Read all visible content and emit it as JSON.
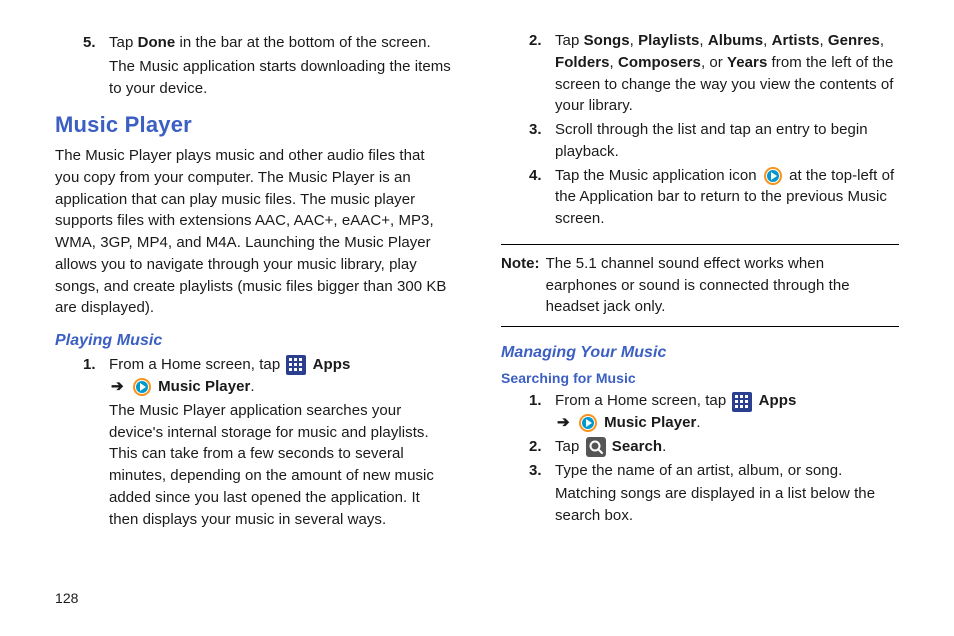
{
  "page_number": "128",
  "left": {
    "step5_num": "5.",
    "step5_a": "Tap ",
    "step5_done": "Done",
    "step5_b": " in the bar at the bottom of the screen.",
    "step5_follow": "The Music application starts downloading the items to your device.",
    "section_title": "Music Player",
    "section_desc": "The Music Player plays music and other audio files that you copy from your computer. The Music Player is an application that can play music files. The music player supports files with extensions AAC, AAC+, eAAC+, MP3, WMA, 3GP, MP4, and M4A. Launching the Music Player allows you to navigate through your music library, play songs, and create playlists (music files bigger than 300 KB are displayed).",
    "playing_title": "Playing Music",
    "pm1_num": "1.",
    "pm1_a": "From a Home screen, tap ",
    "pm1_apps": "Apps",
    "pm1_arrow": "➔",
    "pm1_mp": "Music Player",
    "pm1_period": ".",
    "pm1_follow": "The Music Player application searches your device's internal storage for music and playlists. This can take from a few seconds to several minutes, depending on the amount of new music added since you last opened the application. It then displays your music in several ways."
  },
  "right": {
    "r2_num": "2.",
    "r2_a": "Tap ",
    "r2_songs": "Songs",
    "r2_c1": ", ",
    "r2_playlists": "Playlists",
    "r2_c2": ", ",
    "r2_albums": "Albums",
    "r2_c3": ", ",
    "r2_artists": "Artists",
    "r2_c4": ", ",
    "r2_genres": "Genres",
    "r2_c5": ", ",
    "r2_folders": "Folders",
    "r2_c6": ", ",
    "r2_composers": "Composers",
    "r2_c7": ", or ",
    "r2_years": "Years",
    "r2_b": " from the left of the screen to change the way you view the contents of your library.",
    "r3_num": "3.",
    "r3_txt": "Scroll through the list and tap an entry to begin playback.",
    "r4_num": "4.",
    "r4_a": "Tap the Music application icon ",
    "r4_b": " at the top-left of the Application bar to return to the previous Music screen.",
    "note_label": "Note:",
    "note_text": "The 5.1 channel sound effect works when earphones or sound is connected through the headset jack only.",
    "manage_title": "Managing Your Music",
    "search_title": "Searching for Music",
    "s1_num": "1.",
    "s1_a": "From a Home screen, tap ",
    "s1_apps": "Apps",
    "s1_arrow": "➔",
    "s1_mp": "Music Player",
    "s1_period": ".",
    "s2_num": "2.",
    "s2_a": "Tap ",
    "s2_search": "Search",
    "s2_period": ".",
    "s3_num": "3.",
    "s3_txt": "Type the name of an artist, album, or song.",
    "s3_follow": "Matching songs are displayed in a list below the search box."
  }
}
